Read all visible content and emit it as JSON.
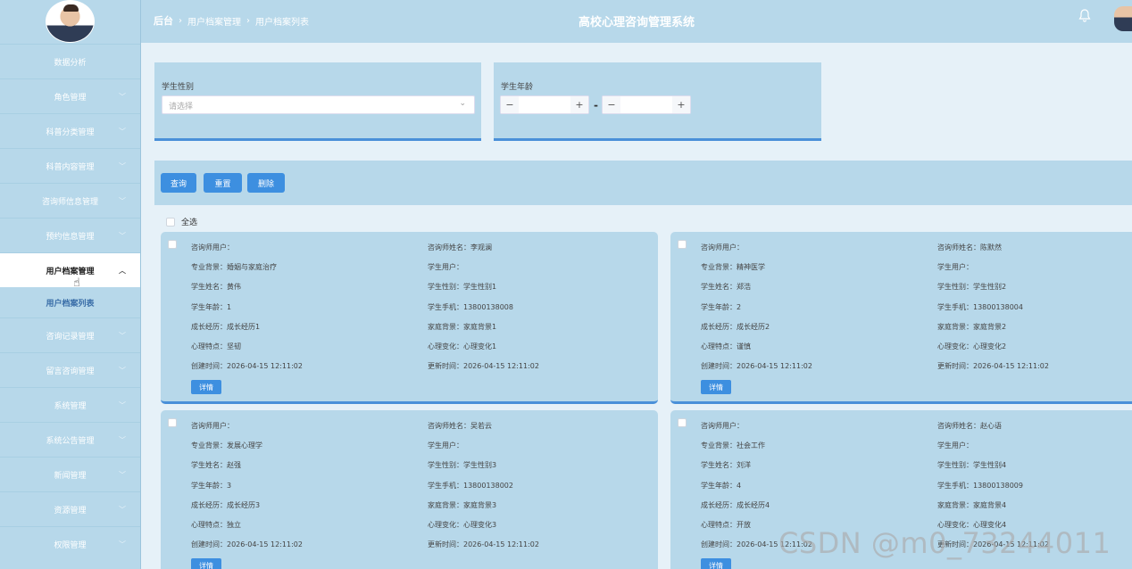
{
  "sidebar": {
    "items": [
      {
        "label": "数据分析",
        "chevron": false
      },
      {
        "label": "角色管理",
        "chevron": true
      },
      {
        "label": "科普分类管理",
        "chevron": true
      },
      {
        "label": "科普内容管理",
        "chevron": true
      },
      {
        "label": "咨询师信息管理",
        "chevron": true
      },
      {
        "label": "预约信息管理",
        "chevron": true
      },
      {
        "label": "用户档案管理",
        "chevron": true,
        "active": true
      },
      {
        "label": "咨询记录管理",
        "chevron": true
      },
      {
        "label": "留言咨询管理",
        "chevron": true
      },
      {
        "label": "系统管理",
        "chevron": true
      },
      {
        "label": "系统公告管理",
        "chevron": true
      },
      {
        "label": "新闻管理",
        "chevron": true
      },
      {
        "label": "资源管理",
        "chevron": true
      },
      {
        "label": "权限管理",
        "chevron": true
      }
    ],
    "submenu": {
      "label": "用户档案列表"
    }
  },
  "header": {
    "breadcrumb": [
      "后台",
      "用户档案管理",
      "用户档案列表"
    ],
    "title": "高校心理咨询管理系统"
  },
  "search": {
    "gender_label": "学生性别",
    "gender_placeholder": "请选择",
    "age_label": "学生年龄",
    "minus": "−",
    "plus": "+",
    "dash": "-"
  },
  "actions": {
    "query": "查询",
    "reset": "重置",
    "delete": "删除"
  },
  "select_all": "全选",
  "detail_label": "详情",
  "cards": [
    {
      "counselor_user": "咨询师用户：",
      "counselor_name": "咨询师姓名：李观澜",
      "background": "专业背景：婚姻与家庭治疗",
      "student_user": "学生用户：",
      "student_name": "学生姓名：黄伟",
      "gender": "学生性别：学生性别1",
      "age": "学生年龄：1",
      "phone": "学生手机：13800138008",
      "growth": "成长经历：成长经历1",
      "family": "家庭背景：家庭背景1",
      "trait": "心理特点：坚韧",
      "change": "心理变化：心理变化1",
      "created": "创建时间：2026-04-15 12:11:02",
      "updated": "更新时间：2026-04-15 12:11:02"
    },
    {
      "counselor_user": "咨询师用户：",
      "counselor_name": "咨询师姓名：陈默然",
      "background": "专业背景：精神医学",
      "student_user": "学生用户：",
      "student_name": "学生姓名：郑浩",
      "gender": "学生性别：学生性别2",
      "age": "学生年龄：2",
      "phone": "学生手机：13800138004",
      "growth": "成长经历：成长经历2",
      "family": "家庭背景：家庭背景2",
      "trait": "心理特点：谨慎",
      "change": "心理变化：心理变化2",
      "created": "创建时间：2026-04-15 12:11:02",
      "updated": "更新时间：2026-04-15 12:11:02"
    },
    {
      "counselor_user": "咨询师用户：",
      "counselor_name": "咨询师姓名：吴若云",
      "background": "专业背景：发展心理学",
      "student_user": "学生用户：",
      "student_name": "学生姓名：赵强",
      "gender": "学生性别：学生性别3",
      "age": "学生年龄：3",
      "phone": "学生手机：13800138002",
      "growth": "成长经历：成长经历3",
      "family": "家庭背景：家庭背景3",
      "trait": "心理特点：独立",
      "change": "心理变化：心理变化3",
      "created": "创建时间：2026-04-15 12:11:02",
      "updated": "更新时间：2026-04-15 12:11:02"
    },
    {
      "counselor_user": "咨询师用户：",
      "counselor_name": "咨询师姓名：赵心语",
      "background": "专业背景：社会工作",
      "student_user": "学生用户：",
      "student_name": "学生姓名：刘洋",
      "gender": "学生性别：学生性别4",
      "age": "学生年龄：4",
      "phone": "学生手机：13800138009",
      "growth": "成长经历：成长经历4",
      "family": "家庭背景：家庭背景4",
      "trait": "心理特点：开放",
      "change": "心理变化：心理变化4",
      "created": "创建时间：2026-04-15 12:11:02",
      "updated": "更新时间：2026-04-15 12:11:02"
    }
  ],
  "watermark": "CSDN @m0_73244011"
}
